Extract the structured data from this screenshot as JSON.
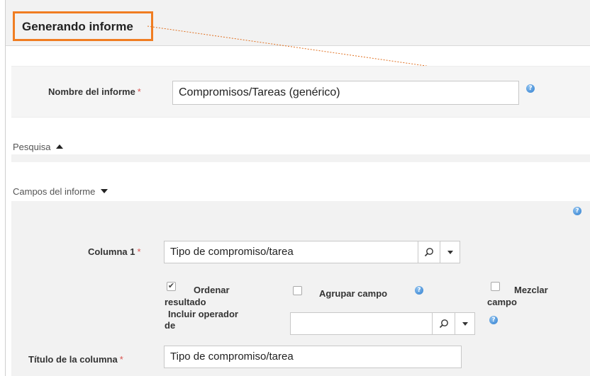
{
  "header": {
    "title": "Generando informe"
  },
  "report_name": {
    "label": "Nombre del informe",
    "required_mark": "*",
    "value": "Compromisos/Tareas (genérico)",
    "help_icon": "help-icon"
  },
  "sections": {
    "search": {
      "label": "Pesquisa",
      "state": "collapsed"
    },
    "fields": {
      "label": "Campos del informe",
      "state": "expanded"
    }
  },
  "column1": {
    "label": "Columna 1",
    "required_mark": "*",
    "value": "Tipo de compromiso/tarea",
    "search_icon": "search-icon",
    "dropdown_icon": "caret-down-icon"
  },
  "options": {
    "sort": {
      "label_line1": "Ordenar",
      "label_line2": "resultado",
      "checked": true
    },
    "group": {
      "label": "Agrupar campo",
      "checked": false
    },
    "merge": {
      "label_line1": "Mezclar",
      "label_line2": "campo",
      "checked": false
    },
    "operator": {
      "label_line1": "Incluir operador",
      "label_line2": "de",
      "value": ""
    }
  },
  "column_title": {
    "label": "Título de la columna",
    "required_mark": "*",
    "value": "Tipo de compromiso/tarea"
  },
  "colors": {
    "accent": "#f07d22",
    "required": "#d9534f",
    "help": "#2f7fd0"
  }
}
